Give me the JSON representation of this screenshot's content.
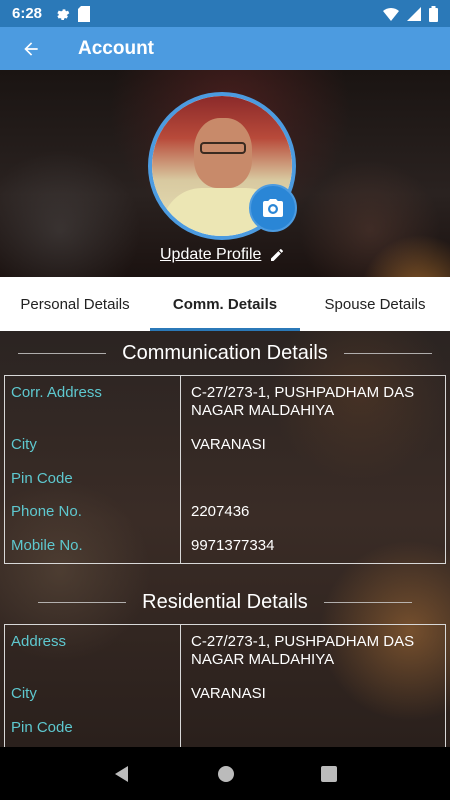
{
  "status_bar": {
    "time": "6:28"
  },
  "app_bar": {
    "title": "Account"
  },
  "profile": {
    "update_label": "Update Profile"
  },
  "tabs": [
    {
      "label": "Personal Details",
      "active": false
    },
    {
      "label": "Comm. Details",
      "active": true
    },
    {
      "label": "Spouse Details",
      "active": false
    }
  ],
  "communication": {
    "heading": "Communication Details",
    "rows": [
      {
        "label": "Corr. Address",
        "value": "C-27/273-1, PUSHPADHAM DAS NAGAR MALDAHIYA"
      },
      {
        "label": "City",
        "value": "VARANASI"
      },
      {
        "label": "Pin Code",
        "value": ""
      },
      {
        "label": "Phone No.",
        "value": "2207436"
      },
      {
        "label": "Mobile No.",
        "value": "9971377334"
      }
    ]
  },
  "residential": {
    "heading": "Residential Details",
    "rows": [
      {
        "label": "Address",
        "value": "C-27/273-1, PUSHPADHAM DAS NAGAR MALDAHIYA"
      },
      {
        "label": "City",
        "value": "VARANASI"
      },
      {
        "label": "Pin Code",
        "value": ""
      }
    ]
  },
  "colors": {
    "primary": "#4c9be0",
    "status_bar": "#2b79b8",
    "label_teal": "#5ec8cf",
    "tab_indicator": "#2b79b8"
  },
  "icons": {
    "back": "arrow-left-icon",
    "camera": "camera-icon",
    "edit": "pencil-icon"
  }
}
